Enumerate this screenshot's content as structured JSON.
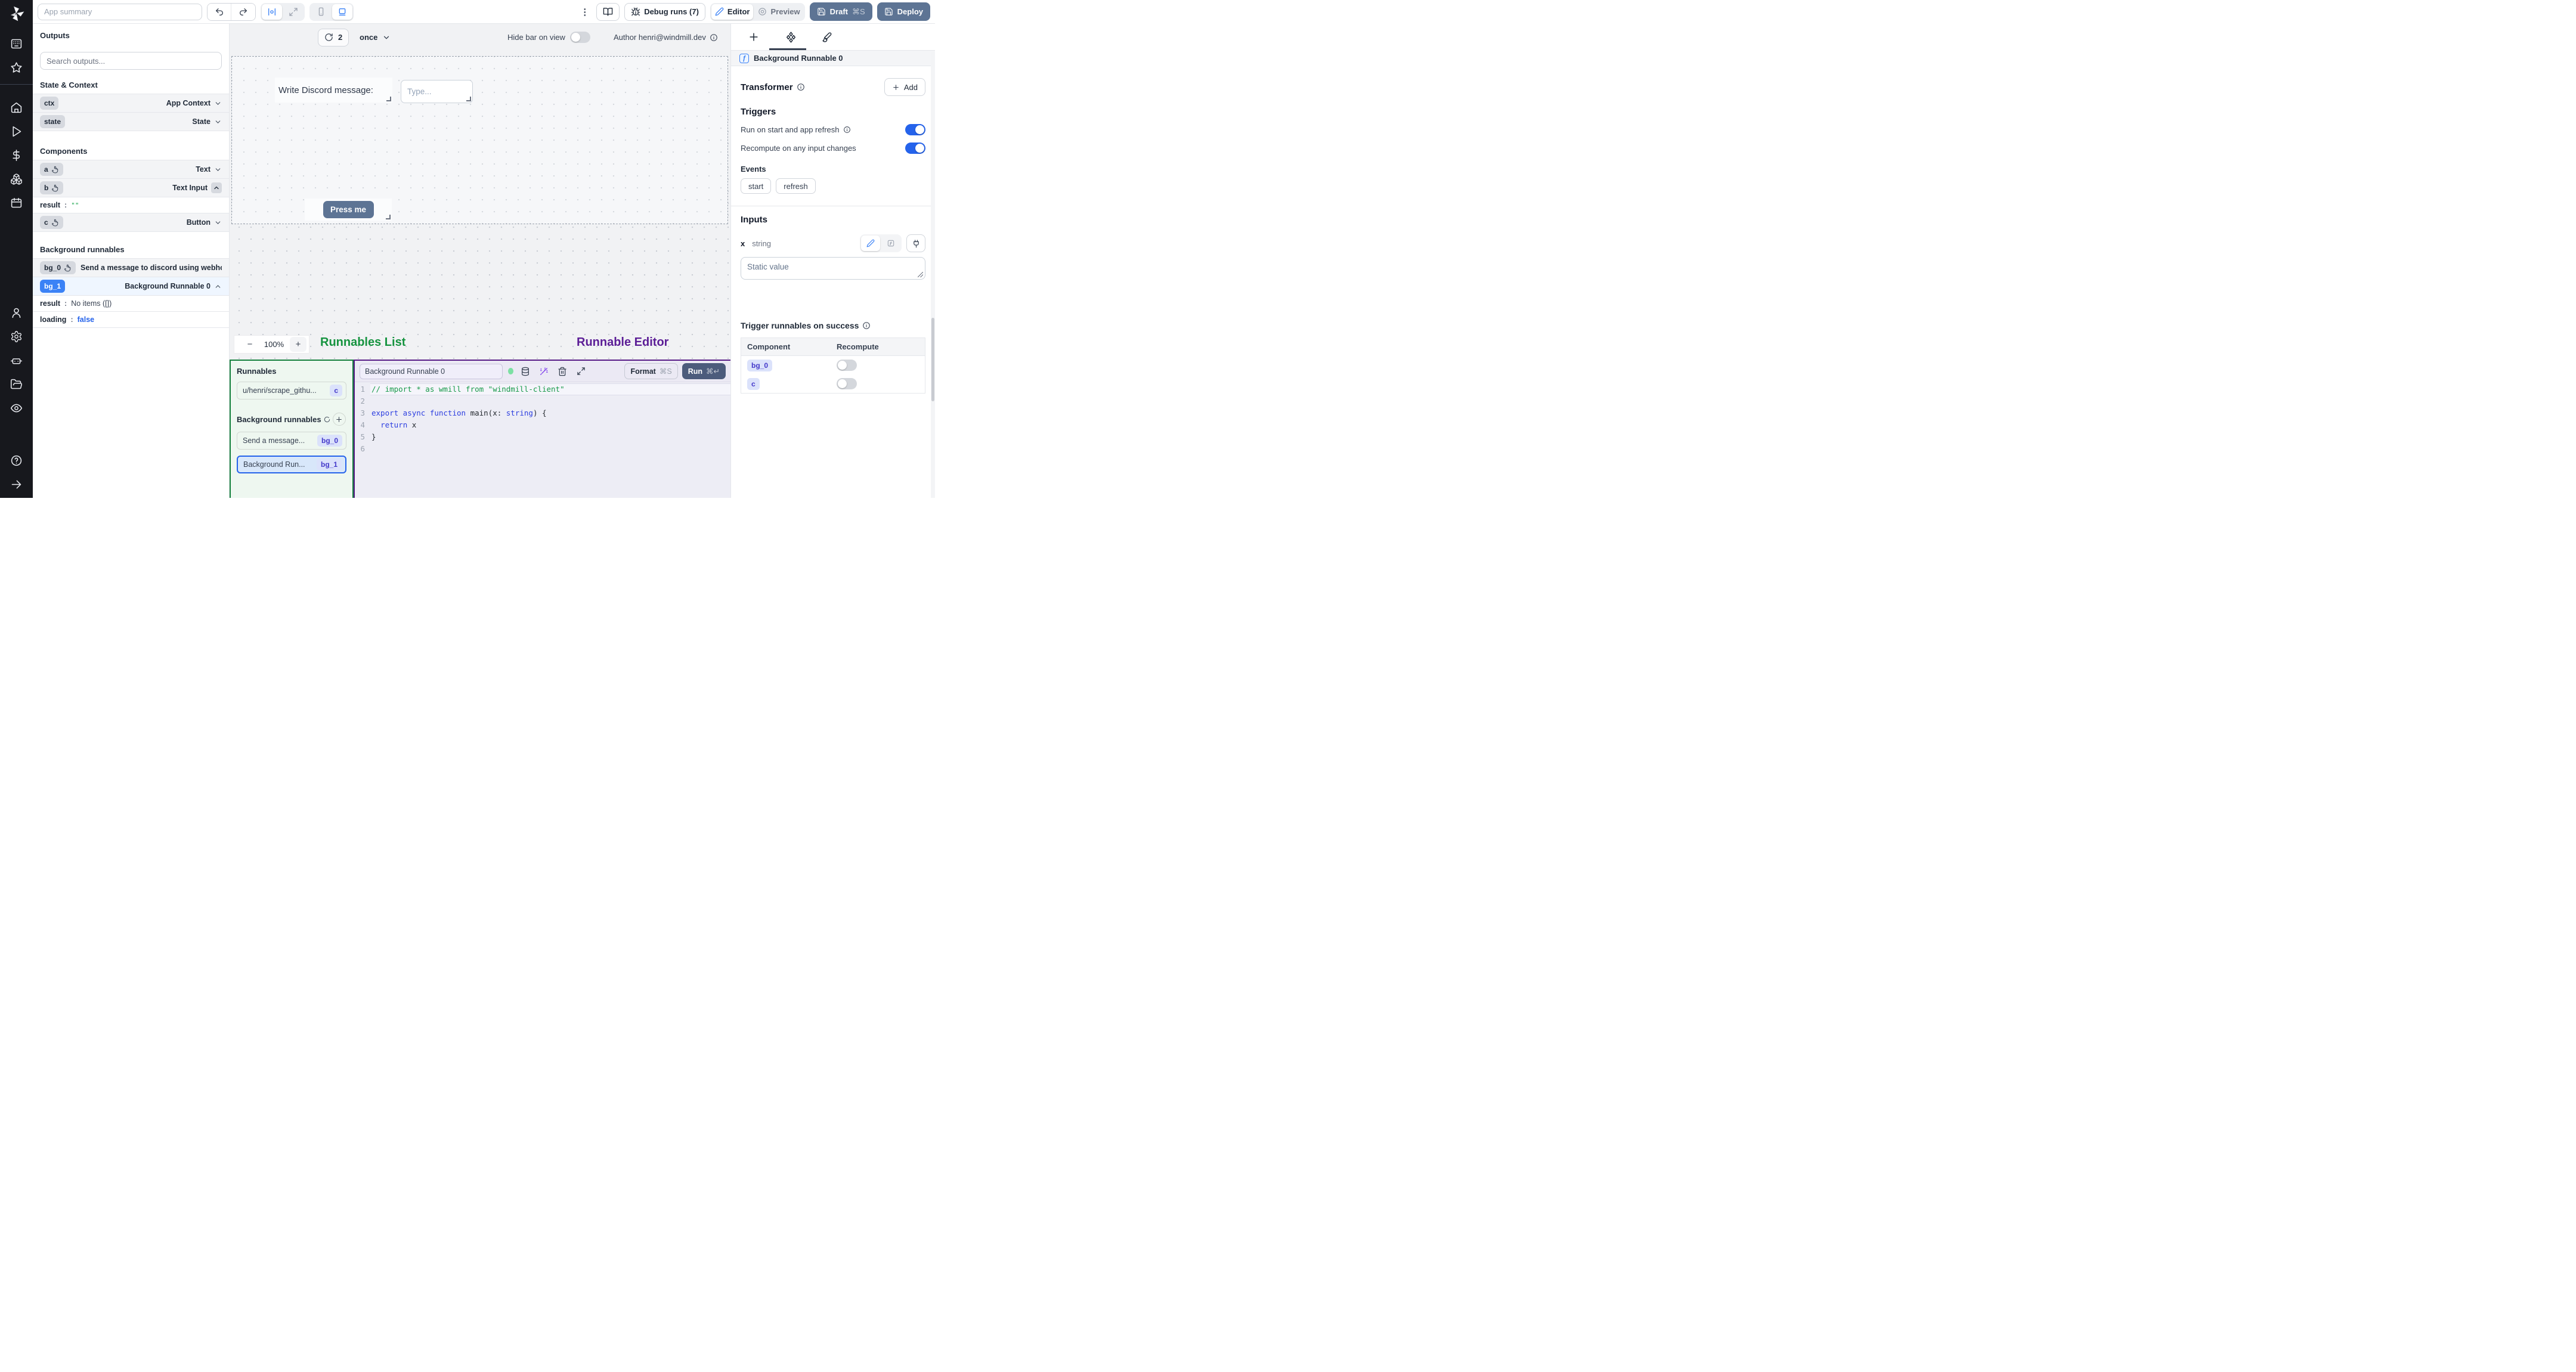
{
  "colors": {
    "accent": "#2563eb",
    "slate_button": "#5d7494",
    "run_button": "#4c5c7c",
    "green_label": "#15933f",
    "purple_label": "#5b1d96",
    "badge_blue": "#3b82f6"
  },
  "sidebar": {
    "icons_top": [
      "apps-icon",
      "star-icon"
    ],
    "icons_main": [
      "home-icon",
      "play-icon",
      "dollar-icon",
      "boxes-icon",
      "calendar-icon"
    ],
    "icons_secondary": [
      "user-icon",
      "settings-icon",
      "robot-icon",
      "folder-open-icon",
      "eye-icon"
    ],
    "icons_bottom": [
      "help-icon",
      "arrow-right-icon"
    ]
  },
  "topbar": {
    "app_summary_placeholder": "App summary",
    "debug_runs_label": "Debug runs (7)",
    "editor_label": "Editor",
    "preview_label": "Preview",
    "draft_label": "Draft",
    "draft_shortcut": "⌘S",
    "deploy_label": "Deploy"
  },
  "canvas_bar": {
    "refresh_count": "2",
    "schedule": "once",
    "hide_bar_label": "Hide bar on view",
    "hide_bar_state": "off",
    "author_label": "Author henri@windmill.dev"
  },
  "canvas": {
    "text_widget": "Write Discord message:",
    "input_placeholder": "Type...",
    "button_label": "Press me",
    "zoom_out": "−",
    "zoom_level": "100%",
    "zoom_in": "+",
    "runnables_list_label": "Runnables List",
    "runnable_editor_label": "Runnable Editor"
  },
  "outputs_panel": {
    "title": "Outputs",
    "search_placeholder": "Search outputs...",
    "state_context": {
      "title": "State & Context",
      "rows": [
        {
          "id": "ctx",
          "type": "App Context"
        },
        {
          "id": "state",
          "type": "State"
        }
      ]
    },
    "components": {
      "title": "Components",
      "rows": [
        {
          "id": "a",
          "type": "Text"
        },
        {
          "id": "b",
          "type": "Text Input"
        },
        {
          "id": "c",
          "type": "Button"
        }
      ],
      "b_details": {
        "key": "result",
        "colon": ":",
        "value": "\"\""
      }
    },
    "background_runnables": {
      "title": "Background runnables",
      "rows": [
        {
          "id": "bg_0",
          "label": "Send a message to discord using webhoo"
        },
        {
          "id": "bg_1",
          "label": "Background Runnable 0"
        }
      ],
      "bg1_details": [
        {
          "key": "result",
          "colon": ":",
          "value": "No items ([])"
        },
        {
          "key": "loading",
          "colon": ":",
          "value": "false"
        }
      ]
    }
  },
  "runnables_panel": {
    "title": "Runnables",
    "items": [
      {
        "label": "u/henri/scrape_githu...",
        "badge": "c"
      }
    ],
    "bg_title": "Background runnables",
    "bg_items": [
      {
        "label": "Send a message...",
        "badge": "bg_0"
      },
      {
        "label": "Background Run...",
        "badge": "bg_1"
      }
    ]
  },
  "editor_panel": {
    "name_value": "Background Runnable 0",
    "format_label": "Format",
    "format_shortcut": "⌘S",
    "run_label": "Run",
    "run_shortcut": "⌘↵",
    "code": {
      "lines": [
        {
          "n": "1",
          "active": true,
          "tokens": [
            {
              "c": "cm",
              "t": "// import * as wmill from \"windmill-client\""
            }
          ]
        },
        {
          "n": "2",
          "tokens": []
        },
        {
          "n": "3",
          "tokens": [
            {
              "c": "kw",
              "t": "export async function"
            },
            {
              "c": "pl",
              "t": " main(x: "
            },
            {
              "c": "kw",
              "t": "string"
            },
            {
              "c": "pl",
              "t": ") {"
            }
          ]
        },
        {
          "n": "4",
          "tokens": [
            {
              "c": "pl",
              "t": "  "
            },
            {
              "c": "kw",
              "t": "return"
            },
            {
              "c": "pl",
              "t": " x"
            }
          ]
        },
        {
          "n": "5",
          "tokens": [
            {
              "c": "pl",
              "t": "}"
            }
          ]
        },
        {
          "n": "6",
          "tokens": []
        }
      ]
    }
  },
  "right_panel": {
    "tabs": [
      "plus-icon",
      "component-icon",
      "brush-icon"
    ],
    "header_title": "Background Runnable 0",
    "transformer": {
      "title": "Transformer",
      "add_label": "Add"
    },
    "triggers": {
      "title": "Triggers",
      "toggles": [
        {
          "label": "Run on start and app refresh",
          "state": "on"
        },
        {
          "label": "Recompute on any input changes",
          "state": "on"
        }
      ],
      "events_title": "Events",
      "events": [
        "start",
        "refresh"
      ]
    },
    "inputs": {
      "title": "Inputs",
      "field_name": "x",
      "field_type": "string",
      "static_placeholder": "Static value"
    },
    "trigger_on_success": {
      "title": "Trigger runnables on success",
      "columns": [
        "Component",
        "Recompute"
      ],
      "rows": [
        {
          "component": "bg_0",
          "state": "off"
        },
        {
          "component": "c",
          "state": "off"
        }
      ]
    }
  }
}
